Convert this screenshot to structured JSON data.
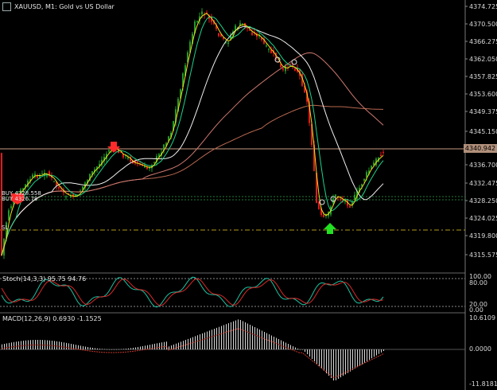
{
  "window": {
    "title": "XAUUSD, M1:  Gold vs US Dollar",
    "icon": "window-menu-icon"
  },
  "colors": {
    "background": "#000000",
    "bull": "#1f9b2a",
    "bear": "#e01b1b",
    "ma_white": "#f0f0f0",
    "ma_yellow": "#f2e21b",
    "ma_green": "#1cd38b",
    "ma_brown": "#b86850",
    "ma_pink": "#d07a72",
    "bid_line": "#c79a82",
    "sl_line": "#b39a1a",
    "dotted_green": "#1f7d34",
    "stoch_main": "#1dc2a2",
    "stoch_signal": "#d92a2a",
    "macd_hist": "#d9d9d9",
    "macd_signal": "#c0392b"
  },
  "price_axis": {
    "labels": [
      "4374.725",
      "4370.500",
      "4366.275",
      "4362.050",
      "4357.825",
      "4353.600",
      "4349.375",
      "4345.150",
      "4336.700",
      "4332.475",
      "4328.250",
      "4324.025",
      "4319.800",
      "4315.575"
    ],
    "current_price": "4340.942"
  },
  "trade_lines": {
    "buy_label": "BUY",
    "buy_value": "4328.558",
    "stop_label": "SL",
    "stop_marker_label": "BUY",
    "stop_marker_value": "4326.78"
  },
  "stochastic": {
    "title": "Stoch(14,3,3) 95.75 94.76",
    "levels": [
      "100.00",
      "80.00",
      "20.00",
      "0.00"
    ]
  },
  "macd": {
    "title": "MACD(12,26,9) 0.6930 -1.1525",
    "levels": [
      "10.6109",
      "0.0000",
      "-11.8181"
    ]
  },
  "markers": {
    "down_arrow": "sell-arrow-icon",
    "up_arrow": "buy-arrow-icon"
  }
}
